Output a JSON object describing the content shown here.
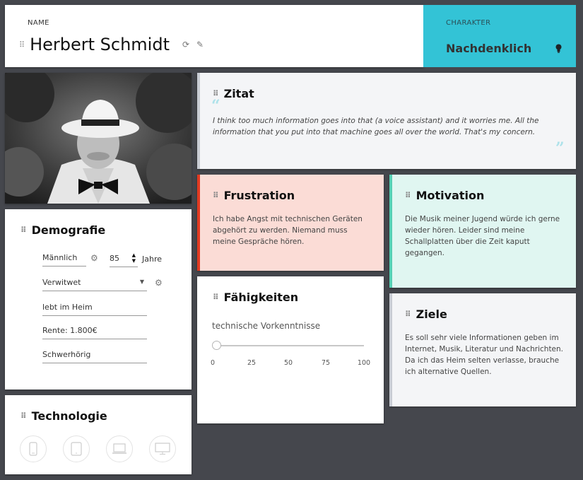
{
  "header": {
    "name_label": "NAME",
    "name": "Herbert Schmidt",
    "refresh_icon": "refresh-icon",
    "edit_icon": "pencil-icon",
    "character_label": "CHARAKTER",
    "character": "Nachdenklich",
    "character_icon": "lightbulb-icon",
    "character_color": "#33c3d6"
  },
  "demografie": {
    "title": "Demografie",
    "gender": "Männlich",
    "age": "85",
    "age_unit": "Jahre",
    "status": "Verwitwet",
    "residence": "lebt im Heim",
    "pension": "Rente: 1.800€",
    "condition": "Schwerhörig"
  },
  "technologie": {
    "title": "Technologie",
    "devices": [
      "smartphone-icon",
      "tablet-icon",
      "laptop-icon",
      "monitor-icon"
    ]
  },
  "zitat": {
    "title": "Zitat",
    "text": "I think too much information goes into that (a voice assistant) and it worries me. All the information that you put into that machine goes all over the world. That's my concern."
  },
  "frustration": {
    "title": "Frustration",
    "text": "Ich habe Angst mit technischen Geräten abgehört zu werden. Niemand muss meine Gespräche hören.",
    "accent": "#e23a22"
  },
  "motivation": {
    "title": "Motivation",
    "text": "Die Musik meiner Jugend würde ich gerne wieder hören. Leider sind meine Schallplatten über die Zeit kaputt gegangen.",
    "accent": "#55d0b4"
  },
  "faehigkeiten": {
    "title": "Fähigkeiten",
    "skill_label": "technische Vorkenntnisse",
    "skill_value": 0,
    "ticks": [
      "0",
      "25",
      "50",
      "75",
      "100"
    ]
  },
  "ziele": {
    "title": "Ziele",
    "text": "Es soll sehr viele Informationen geben im Internet, Musik, Literatur und Nachrichten. Da ich das Heim selten verlasse, brauche ich alternative Quellen."
  }
}
